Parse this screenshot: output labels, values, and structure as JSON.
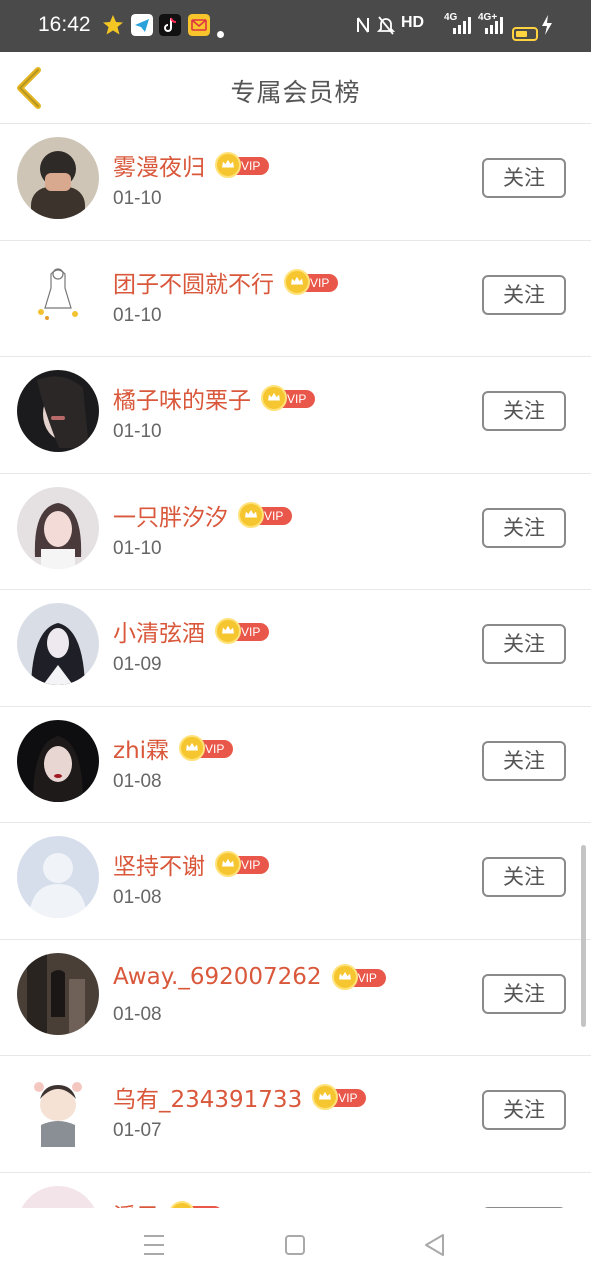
{
  "status_bar": {
    "time": "16:42",
    "network": "HD",
    "signal_1": "4G",
    "signal_2": "4G+",
    "battery_level": 0.6,
    "app_icons": [
      "star-icon",
      "telegram-icon",
      "tiktok-icon",
      "mail-icon"
    ]
  },
  "header": {
    "title": "专属会员榜",
    "back_icon": "chevron-left-icon"
  },
  "vip_label": "VIP",
  "follow_label": "关注",
  "members": [
    {
      "name": "雾漫夜归",
      "date": "01-10"
    },
    {
      "name": "团子不圆就不行",
      "date": "01-10"
    },
    {
      "name": "橘子味的栗子",
      "date": "01-10"
    },
    {
      "name": "一只胖汐汐",
      "date": "01-10"
    },
    {
      "name": "小清弦酒",
      "date": "01-09"
    },
    {
      "name": "zhi霖",
      "date": "01-08"
    },
    {
      "name": "坚持不谢",
      "date": "01-08"
    },
    {
      "name": "Away._692007262",
      "date": "01-08"
    },
    {
      "name": "乌有_234391733",
      "date": "01-07"
    },
    {
      "name": "溪子",
      "date": ""
    }
  ],
  "nav": {
    "menu_icon": "menu-icon",
    "home_icon": "home-square-icon",
    "back_icon": "back-triangle-icon"
  },
  "colors": {
    "name": "#d9573a",
    "vip_badge": "#e8574a",
    "crown": "#f6c630",
    "back_arrow": "#e2b521"
  }
}
